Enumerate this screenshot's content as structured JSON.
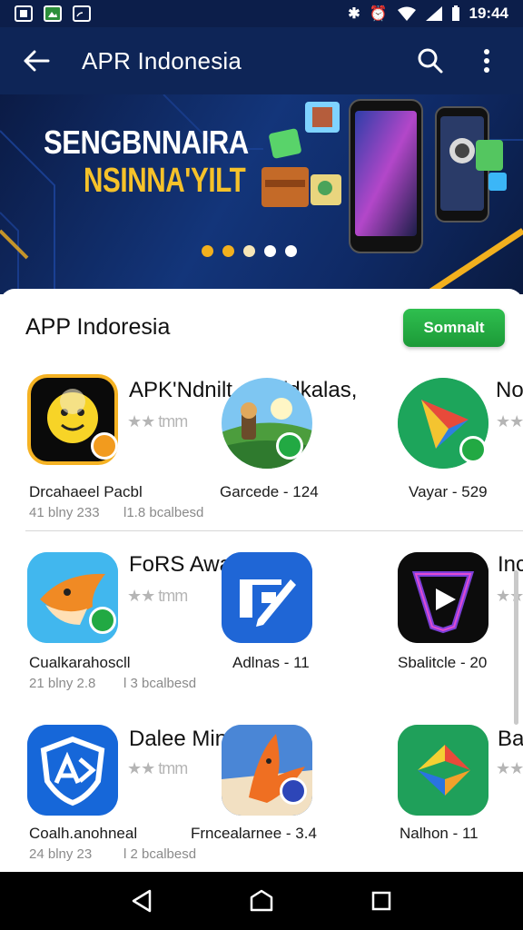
{
  "status_bar": {
    "time": "19:44",
    "icons": [
      "screenshot-icon",
      "gallery-icon",
      "cast-icon",
      "bluetooth-icon",
      "alarm-icon",
      "wifi-icon",
      "signal-icon",
      "battery-icon"
    ]
  },
  "app_bar": {
    "title": "APR Indonesia",
    "back_icon": "arrow-left-icon",
    "search_icon": "search-icon",
    "menu_icon": "more-vert-icon"
  },
  "banner": {
    "headline": "SENGBNNAIRA",
    "subhead": "NSINNA'YILT",
    "dots": 5,
    "active_dot": 0
  },
  "section": {
    "title": "APP Indoresia",
    "button_label": "Somnalt"
  },
  "rows": [
    {
      "title_1": "APK'Ndnilt",
      "title_2": "ddkalas,",
      "title_3": "No",
      "rating": "★★ tmm",
      "items": [
        {
          "name": "Drcahaeel Pacbl",
          "meta_1": "41 blny 233",
          "meta_2": "l1.8 bcalbesd",
          "icon": "smiley-face-icon"
        },
        {
          "name": "Garcede - 124",
          "meta_1": "",
          "meta_2": "",
          "icon": "landscape-game-icon"
        },
        {
          "name": "Vayar - 529",
          "meta_1": "",
          "meta_2": "",
          "icon": "play-triangle-icon"
        }
      ]
    },
    {
      "title_1": "FoRS Awal",
      "title_2": "",
      "title_3": "Inc",
      "rating": "★★ tmm",
      "items": [
        {
          "name": "Cualkarahoscll",
          "meta_1": "21 blny 2.8",
          "meta_2": "l 3 bcalbesd",
          "icon": "fox-icon"
        },
        {
          "name": "Adlnas - 11",
          "meta_1": "",
          "meta_2": "",
          "icon": "edit-box-icon"
        },
        {
          "name": "Sbalitcle - 20",
          "meta_1": "",
          "meta_2": "",
          "icon": "play-shield-icon"
        }
      ]
    },
    {
      "title_1": "Dalee Minni",
      "title_2": "",
      "title_3": "Bal",
      "rating": "★★ tmm",
      "items": [
        {
          "name": "Coalh.anohneal",
          "meta_1": "24 blny 23",
          "meta_2": "l 2 bcalbesd",
          "icon": "ad-shield-icon"
        },
        {
          "name": "Frncealarnee - 3.4",
          "meta_1": "",
          "meta_2": "",
          "icon": "fox-character-icon"
        },
        {
          "name": "Nalhon - 11",
          "meta_1": "",
          "meta_2": "",
          "icon": "colorful-arrow-icon"
        }
      ]
    }
  ],
  "nav_bar": {
    "back_icon": "nav-back-icon",
    "home_icon": "nav-home-icon",
    "recents_icon": "nav-recents-icon"
  },
  "colors": {
    "app_bar": "#0e2557",
    "status_bar": "#0c1e4a",
    "accent_green": "#22a943",
    "banner_yellow": "#f6c22a"
  }
}
